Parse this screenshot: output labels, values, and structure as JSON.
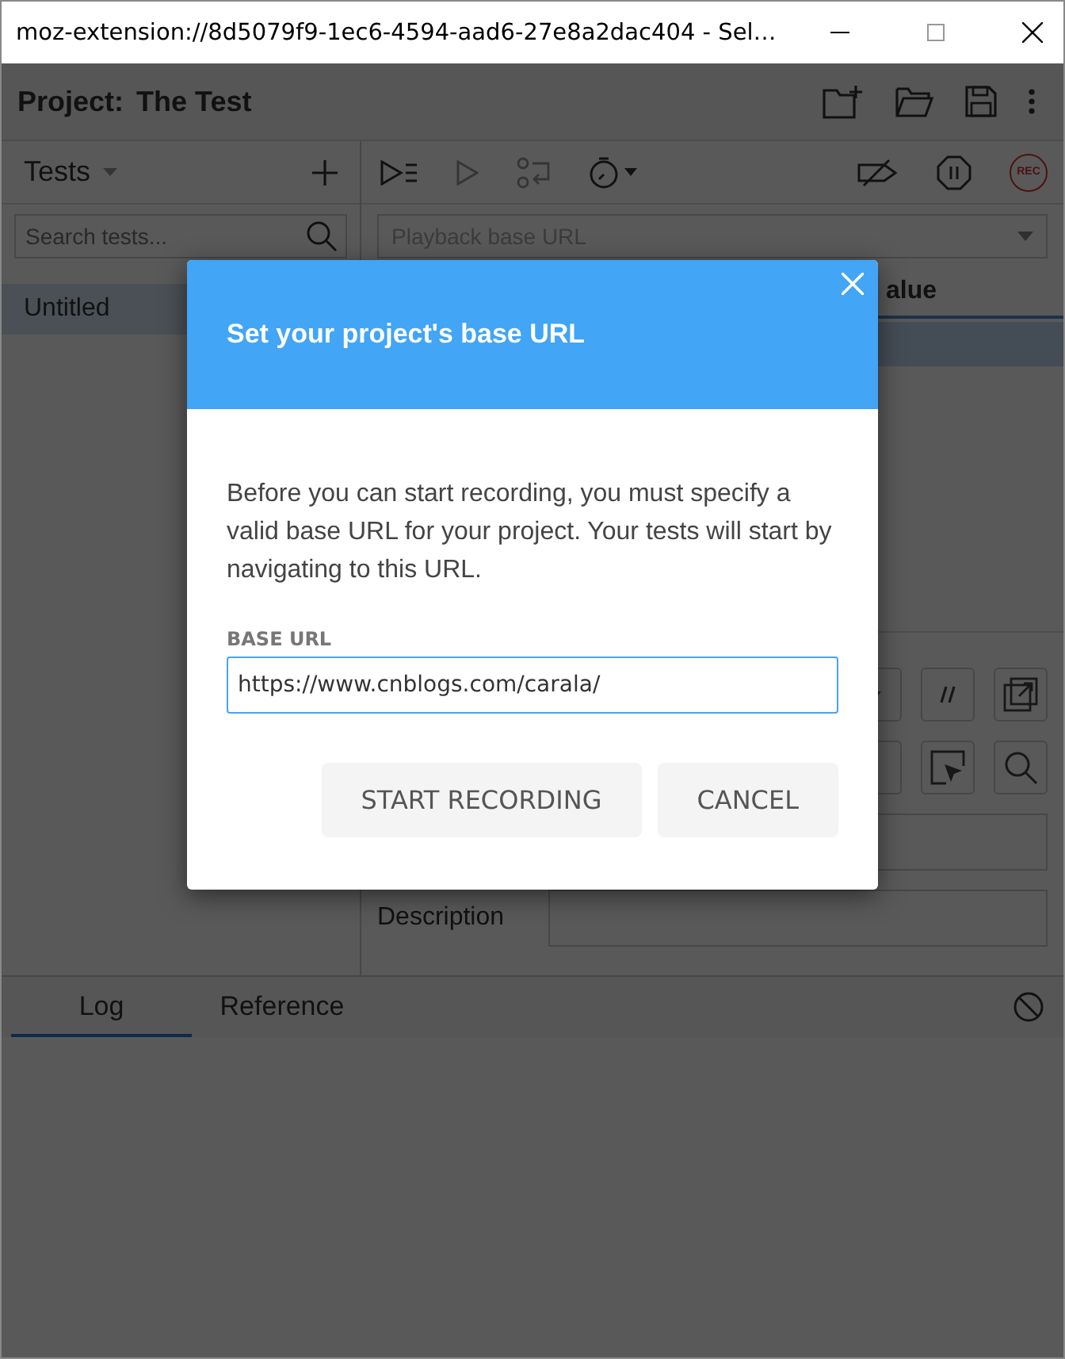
{
  "window": {
    "title": "moz-extension://8d5079f9-1ec6-4594-aad6-27e8a2dac404 - Sel…"
  },
  "project": {
    "label": "Project:",
    "name": "The Test"
  },
  "record_button": {
    "label": "REC"
  },
  "tests_panel": {
    "title": "Tests",
    "search": {
      "placeholder": "Search tests..."
    },
    "tests": [
      {
        "name": "Untitled",
        "selected": true
      }
    ]
  },
  "playback": {
    "placeholder": "Playback base URL"
  },
  "table": {
    "columns": [
      "alue"
    ],
    "rows": [
      {
        "selected": true
      }
    ]
  },
  "command_form": {
    "description_label": "Description"
  },
  "bottom_tabs": [
    {
      "label": "Log",
      "selected": true
    },
    {
      "label": "Reference",
      "selected": false
    }
  ],
  "dialog": {
    "title": "Set your project's base URL",
    "message": "Before you can start recording, you must specify a valid base URL for your project. Your tests will start by navigating to this URL.",
    "field_label": "BASE URL",
    "field_value": "https://www.cnblogs.com/carala/",
    "buttons": [
      {
        "label": "START RECORDING"
      },
      {
        "label": "CANCEL"
      }
    ]
  }
}
